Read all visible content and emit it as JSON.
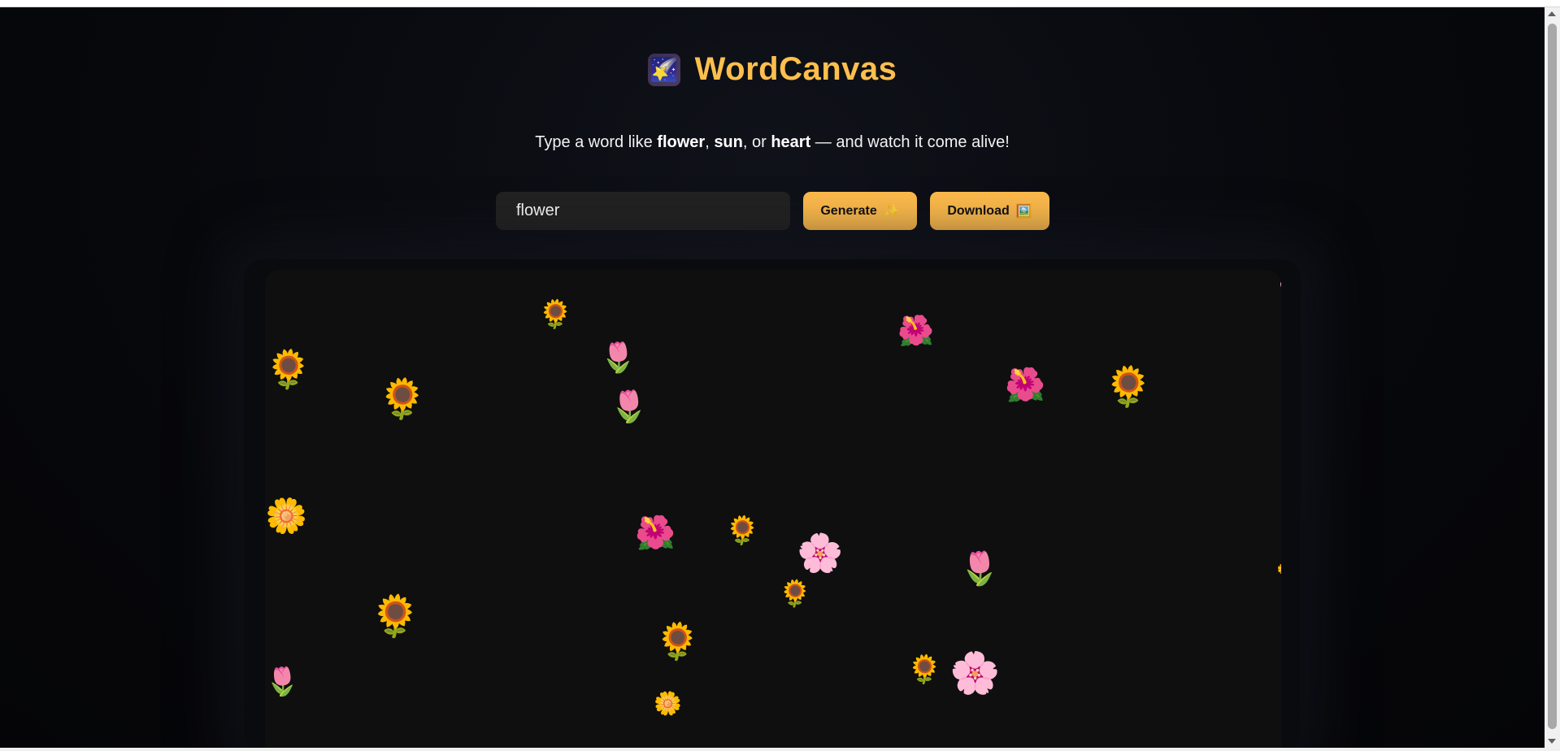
{
  "app": {
    "title": "WordCanvas",
    "logo_icon": "shooting-star-icon",
    "logo_glyph": "🌠"
  },
  "tagline": {
    "prefix": "Type a word like ",
    "word1": "flower",
    "sep1": ", ",
    "word2": "sun",
    "sep2": ", or ",
    "word3": "heart",
    "suffix": " — and watch it come alive!"
  },
  "controls": {
    "input_value": "flower",
    "generate_label": "Generate",
    "generate_emoji": "✨",
    "download_label": "Download",
    "download_emoji": "🖼️"
  },
  "canvas": {
    "background": "#0f0f0f",
    "word": "flower",
    "glyphs": {
      "sunflower": "🌻",
      "tulip": "🌷",
      "hibiscus": "🌺",
      "cherry_blossom": "🌸",
      "blossom": "🌼"
    },
    "flowers": [
      {
        "kind": "sunflower"
      },
      {
        "kind": "tulip"
      },
      {
        "kind": "tulip"
      },
      {
        "kind": "hibiscus"
      },
      {
        "kind": "hibiscus"
      },
      {
        "kind": "sunflower"
      },
      {
        "kind": "sunflower"
      },
      {
        "kind": "sunflower"
      },
      {
        "kind": "cherry_blossom"
      },
      {
        "kind": "blossom"
      },
      {
        "kind": "hibiscus"
      },
      {
        "kind": "sunflower"
      },
      {
        "kind": "cherry_blossom"
      },
      {
        "kind": "tulip"
      },
      {
        "kind": "sunflower"
      },
      {
        "kind": "sunflower"
      },
      {
        "kind": "sunflower"
      },
      {
        "kind": "blossom"
      },
      {
        "kind": "sunflower"
      },
      {
        "kind": "cherry_blossom"
      },
      {
        "kind": "tulip"
      },
      {
        "kind": "blossom"
      }
    ]
  },
  "colors": {
    "accent": "#ffbc4c",
    "title": "#ffbf4d",
    "input_bg": "#222222",
    "page_bg": "#07080c"
  }
}
